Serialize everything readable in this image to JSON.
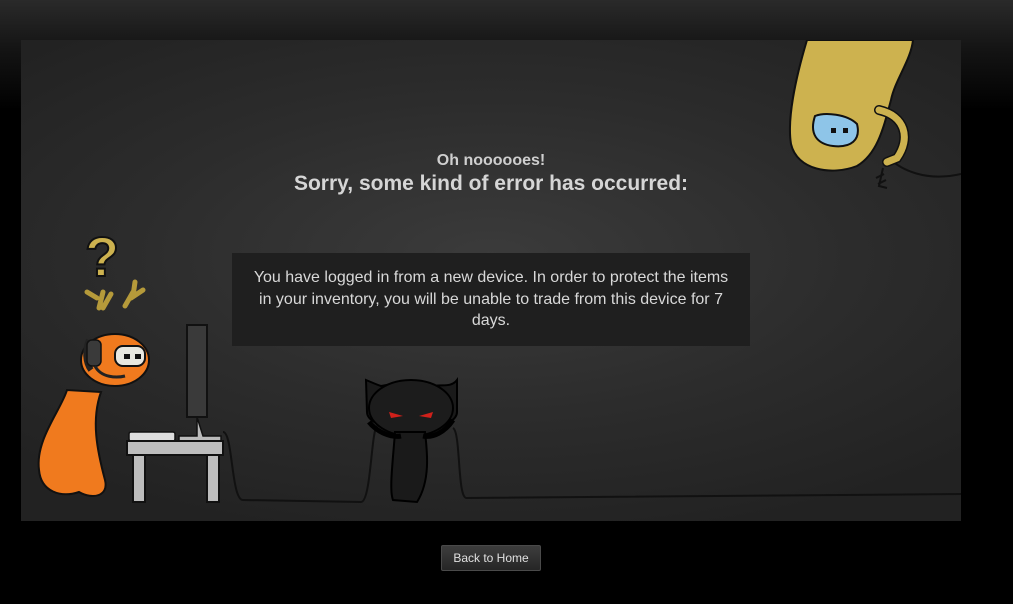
{
  "error": {
    "exclamation": "Oh noooooes!",
    "title": "Sorry, some kind of error has occurred:",
    "message": "You have logged in from a new device. In order to protect the items in your inventory, you will be unable to trade from this device for 7 days."
  },
  "actions": {
    "back_label": "Back to Home"
  },
  "illustration": {
    "question_mark": "?"
  },
  "colors": {
    "background": "#000000",
    "panel": "#2c2c2c",
    "message_box": "#1f1f1f",
    "text": "#d8d8d8",
    "orange_creature": "#f07a1e",
    "yellow_creature": "#cdb24f",
    "black_cat_eyes": "#d0201a"
  }
}
